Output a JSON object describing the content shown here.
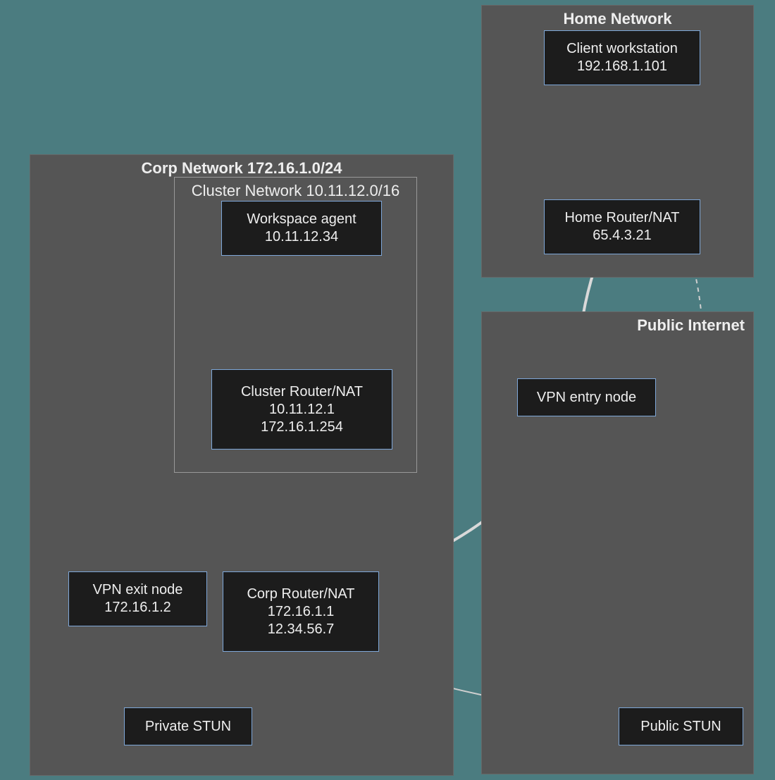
{
  "groups": {
    "home": {
      "title": "Home Network"
    },
    "corp": {
      "title": "Corp Network 172.16.1.0/24"
    },
    "cluster": {
      "title": "Cluster Network 10.11.12.0/16"
    },
    "public": {
      "title": "Public Internet"
    }
  },
  "nodes": {
    "client_ws": {
      "l1": "Client workstation",
      "l2": "192.168.1.101"
    },
    "home_router": {
      "l1": "Home Router/NAT",
      "l2": "65.4.3.21"
    },
    "workspace_agent": {
      "l1": "Workspace agent",
      "l2": "10.11.12.34"
    },
    "cluster_router": {
      "l1": "Cluster Router/NAT",
      "l2": "10.11.12.1",
      "l3": "172.16.1.254"
    },
    "vpn_entry": {
      "l1": "VPN entry node"
    },
    "corp_router": {
      "l1": "Corp Router/NAT",
      "l2": "172.16.1.1",
      "l3": "12.34.56.7"
    },
    "vpn_exit": {
      "l1": "VPN exit node",
      "l2": "172.16.1.2"
    },
    "private_stun": {
      "l1": "Private STUN"
    },
    "public_stun": {
      "l1": "Public STUN"
    }
  }
}
